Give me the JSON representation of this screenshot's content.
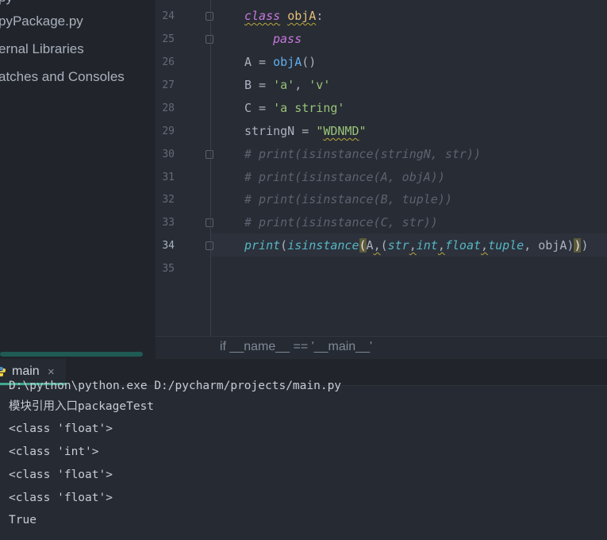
{
  "sidebar": {
    "items": [
      {
        "label": "py"
      },
      {
        "label": "pyPackage.py"
      },
      {
        "label": "ernal Libraries"
      },
      {
        "label": "atches and Consoles"
      }
    ]
  },
  "editor": {
    "line_numbers": [
      "24",
      "25",
      "26",
      "27",
      "28",
      "29",
      "30",
      "31",
      "32",
      "33",
      "34",
      "35"
    ],
    "active_line": "34",
    "lines": {
      "l24_kw": "class",
      "l24_name": "objA",
      "l24_colon": ":",
      "l25": "pass",
      "l26_a": "A = ",
      "l26_b": "objA",
      "l26_c": "()",
      "l27_a": "B = ",
      "l27_s1": "'a'",
      "l27_sep": ", ",
      "l27_s2": "'v'",
      "l28_a": "C = ",
      "l28_s": "'a string'",
      "l29_a": "stringN = ",
      "l29_q1": "\"",
      "l29_s": "WDNMD",
      "l29_q2": "\"",
      "l30": "# print(isinstance(stringN, str))",
      "l31": "# print(isinstance(A, objA))",
      "l32": "# print(isinstance(B, tuple))",
      "l33": "# print(isinstance(C, str))",
      "l34_print": "print",
      "l34_p1": "(",
      "l34_isinst": "isinstance",
      "l34_p2": "(",
      "l34_A": "A",
      "l34_c1": ",",
      "l34_p3": "(",
      "l34_str": "str",
      "l34_c2": ",",
      "l34_int": "int",
      "l34_c3": ",",
      "l34_float": "float",
      "l34_c4": ",",
      "l34_tuple": "tuple",
      "l34_c5": ", ",
      "l34_objA": "objA",
      "l34_p4": ")",
      "l34_p5": ")",
      "l34_p6": ")"
    }
  },
  "breadcrumb": {
    "text": "if __name__ == '__main__'"
  },
  "run_panel": {
    "tab_label": "main",
    "close_glyph": "×"
  },
  "console": {
    "partial_line": "D:\\python\\python.exe D:/pycharm/projects/main.py",
    "lines": [
      "模块引用入口packageTest",
      "<class 'float'>",
      "<class 'int'>",
      "<class 'float'>",
      "<class 'float'>",
      "True"
    ]
  },
  "colors": {
    "keyword": "#c678dd",
    "class_name": "#e5c07b",
    "function": "#61afef",
    "string": "#98c379",
    "comment": "#5c6370",
    "builtin": "#56b6c2",
    "tab_accent": "#3fa98d"
  }
}
